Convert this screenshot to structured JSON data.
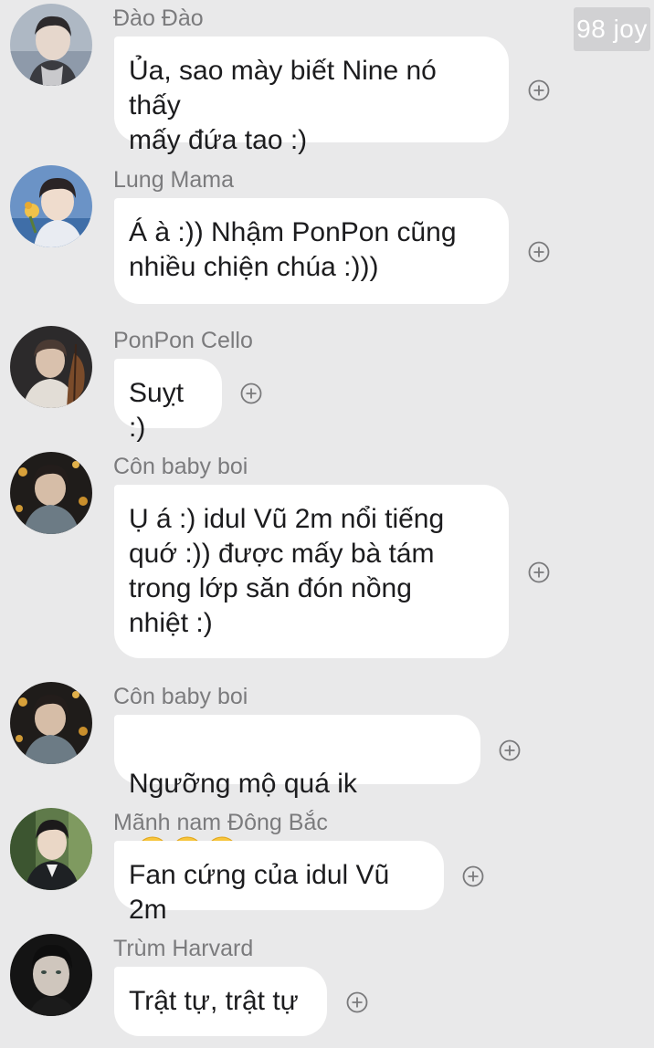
{
  "watermark": "98 joy",
  "messages": [
    {
      "sender": "Đào Đào",
      "text": "Ủa, sao mày biết Nine nó thấy\nmấy đứa tao :)",
      "avatar": "avatar-dao-dao"
    },
    {
      "sender": "Lung Mama",
      "text": "Á à :)) Nhậm PonPon cũng\nnhiều chiện chúa :)))",
      "avatar": "avatar-lung-mama"
    },
    {
      "sender": "PonPon Cello",
      "text": "Suỵt :)",
      "avatar": "avatar-ponpon-cello"
    },
    {
      "sender": "Côn baby boi",
      "text": "Ụ á :) idul Vũ 2m nổi tiếng\nquớ :)) được mấy bà tám\ntrong lớp săn đón nồng\nnhiệt :)",
      "avatar": "avatar-con-baby-boi"
    },
    {
      "sender": "Côn baby boi",
      "text": "Ngưỡng mộ quá ik",
      "emoji": "🥺🥺🥺",
      "avatar": "avatar-con-baby-boi"
    },
    {
      "sender": "Mãnh nam Đông Bắc",
      "text": "Fan cứng của idul Vũ 2m",
      "avatar": "avatar-manh-nam"
    },
    {
      "sender": "Trùm Harvard",
      "text": "Trật tự, trật tự",
      "avatar": "avatar-trum-harvard"
    }
  ],
  "colors": {
    "background": "#e9e9ea",
    "bubble": "#ffffff",
    "text": "#1c1c1e",
    "sender": "#7b7b7d",
    "icon": "#7a7a7c"
  },
  "icons": {
    "react": "add-reaction-icon"
  }
}
